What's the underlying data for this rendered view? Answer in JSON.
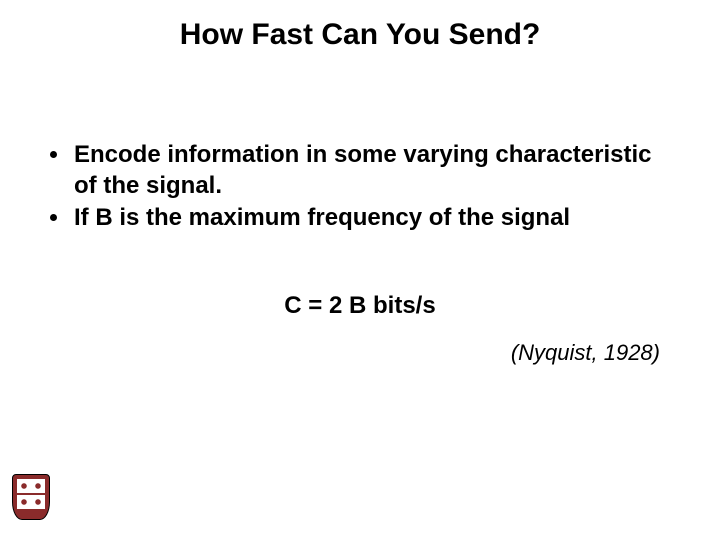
{
  "title": "How Fast Can You Send?",
  "bullets": [
    "Encode information in some varying characteristic of the signal.",
    "If B is the maximum frequency of the signal"
  ],
  "formula": "C = 2 B bits/s",
  "attribution": "(Nyquist, 1928)"
}
